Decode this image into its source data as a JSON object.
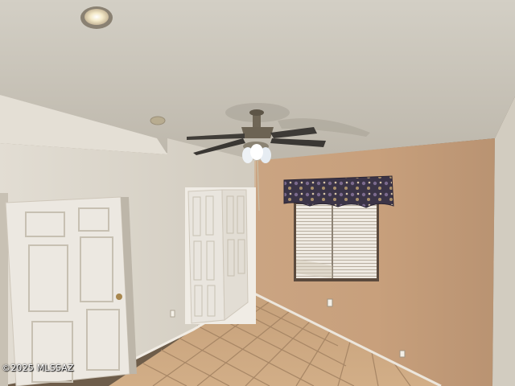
{
  "watermark": {
    "text": "©2025 MLSSAZ"
  },
  "colors": {
    "ceiling": "#c9c4b8",
    "wall_left": "#d9d3c7",
    "wall_back": "#c9a27f",
    "wall_right": "#cfc9bd",
    "floor_tile": "#c8a27a",
    "grout": "#9c7e5f",
    "door": "#e8e4dc",
    "valance": "#3a3446"
  },
  "icons": [
    "ceiling-fan-icon",
    "recessed-light-icon",
    "smoke-detector-icon"
  ]
}
